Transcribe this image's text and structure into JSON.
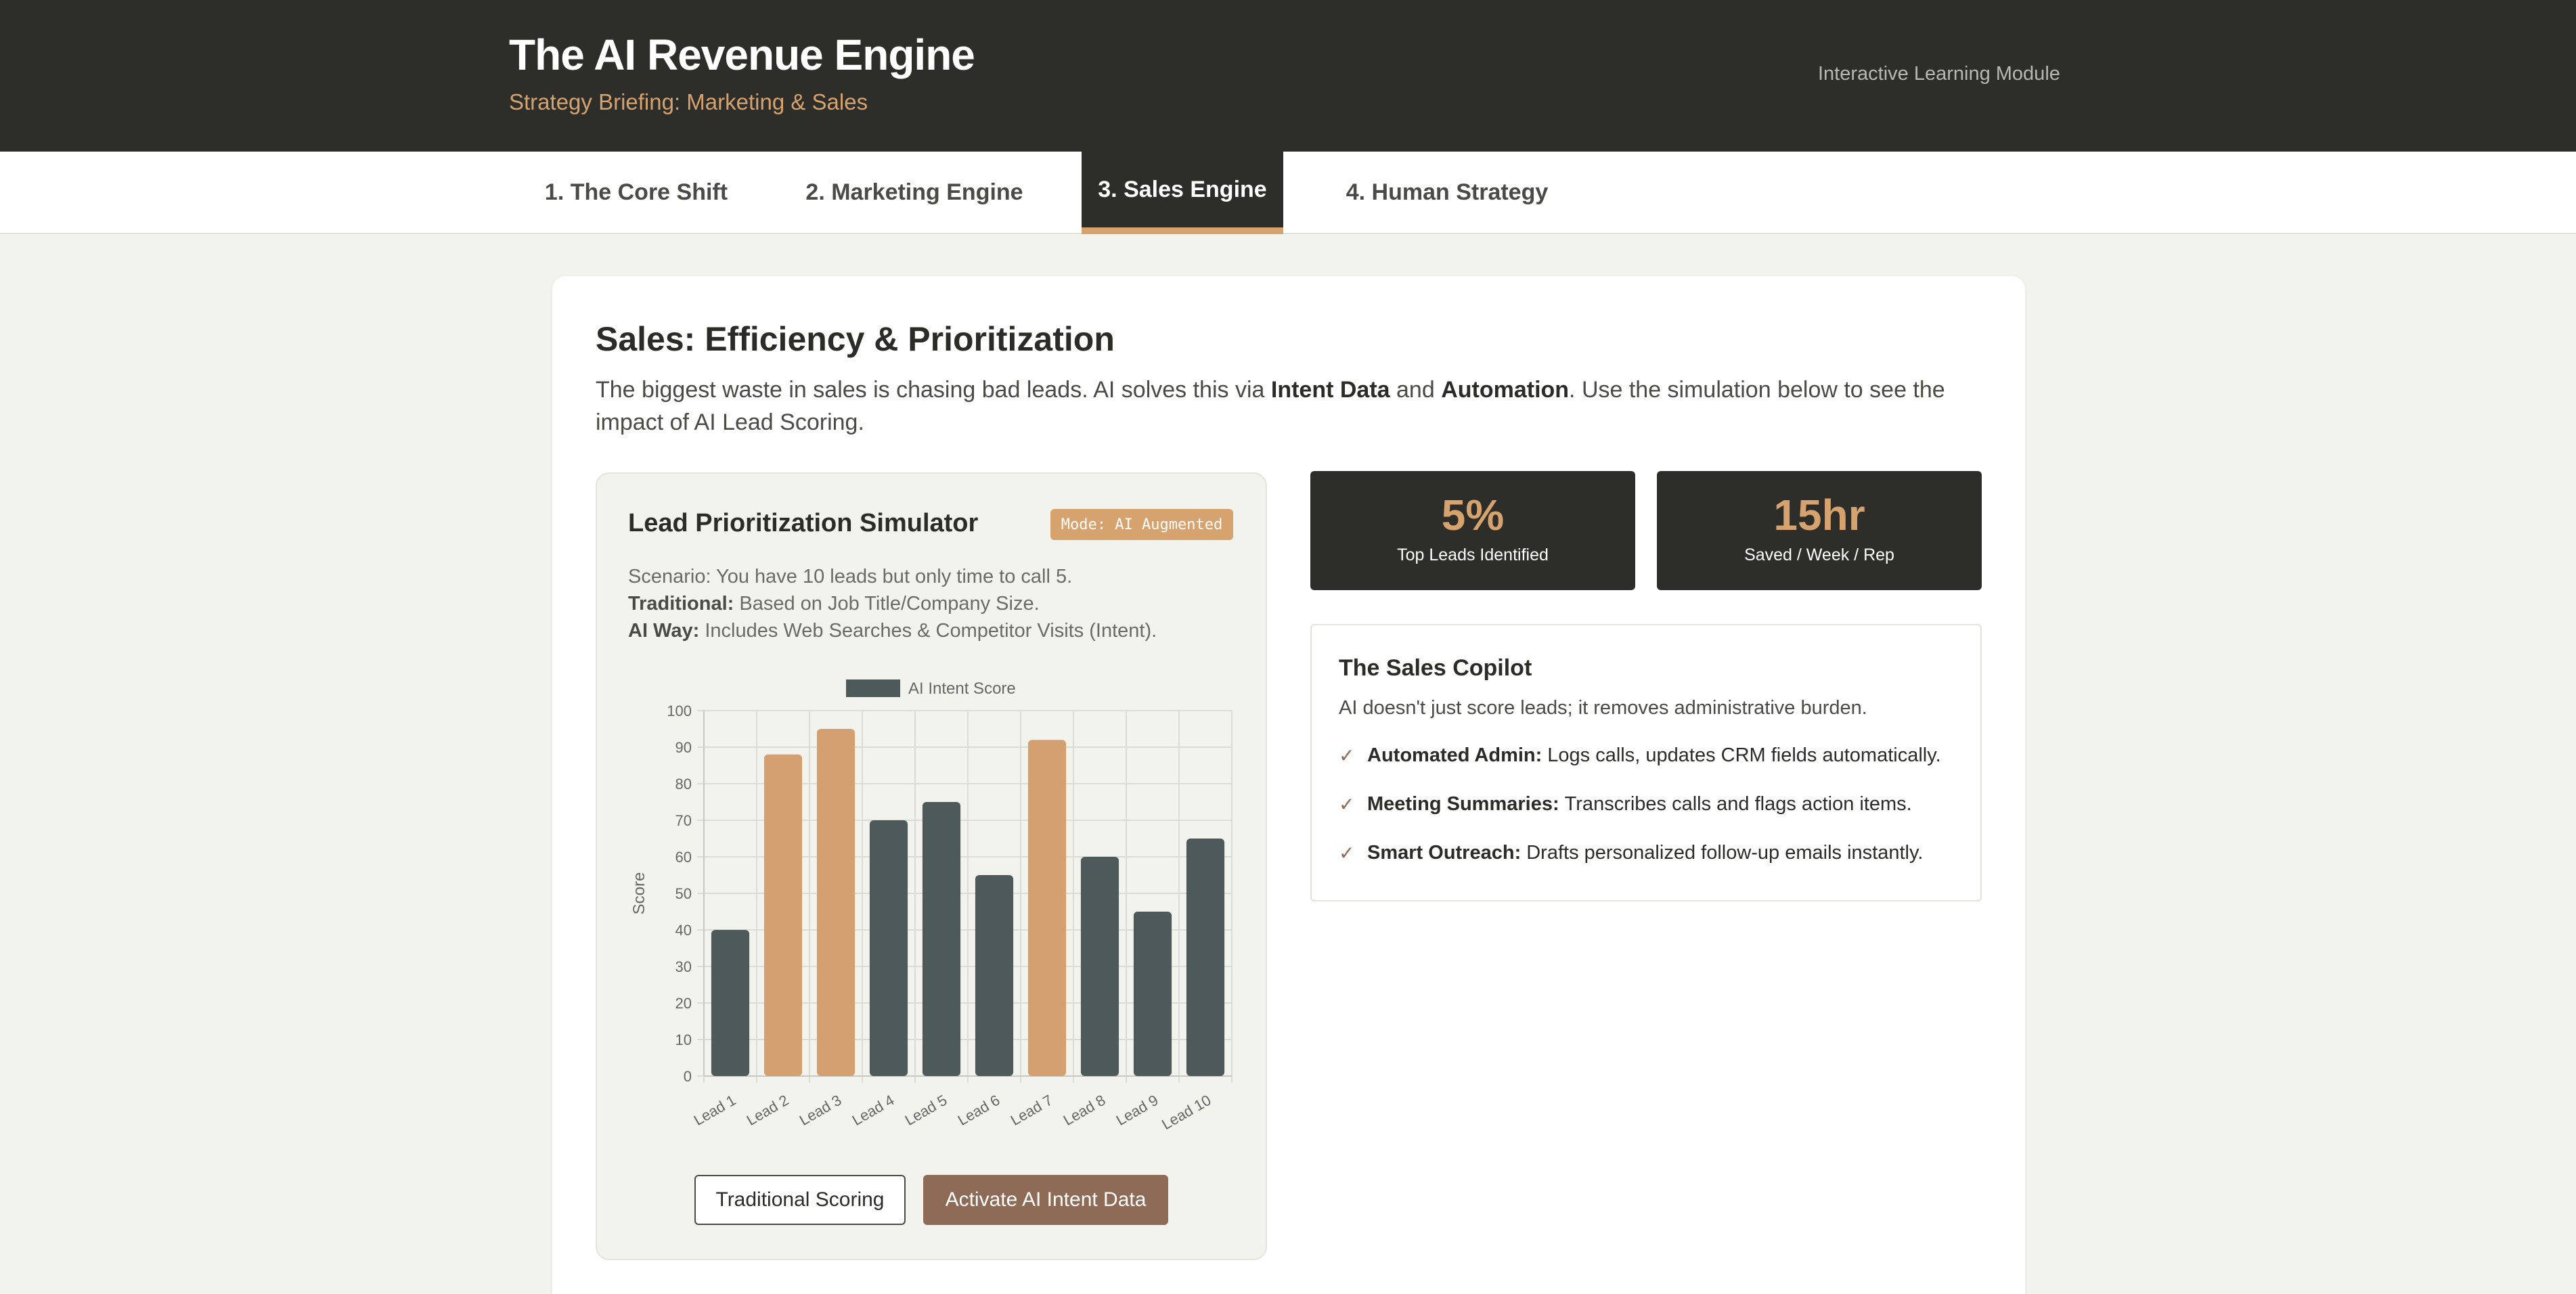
{
  "header": {
    "title": "The AI Revenue Engine",
    "subtitle": "Strategy Briefing: Marketing & Sales",
    "module_label": "Interactive Learning Module"
  },
  "tabs": [
    {
      "label": "1. The Core Shift"
    },
    {
      "label": "2. Marketing Engine"
    },
    {
      "label": "3. Sales Engine",
      "active": true
    },
    {
      "label": "4. Human Strategy"
    }
  ],
  "section": {
    "title": "Sales: Efficiency & Prioritization",
    "desc_part1": "The biggest waste in sales is chasing bad leads. AI solves this via ",
    "desc_bold1": "Intent Data",
    "desc_part2": " and ",
    "desc_bold2": "Automation",
    "desc_part3": ". Use the simulation below to see the impact of AI Lead Scoring."
  },
  "simulator": {
    "title": "Lead Prioritization Simulator",
    "mode_badge": "Mode: AI Augmented",
    "scenario": "Scenario: You have 10 leads but only time to call 5.",
    "traditional_label": "Traditional:",
    "traditional_text": " Based on Job Title/Company Size.",
    "ai_label": "AI Way:",
    "ai_text": " Includes Web Searches & Competitor Visits (Intent).",
    "btn_traditional": "Traditional Scoring",
    "btn_ai": "Activate AI Intent Data"
  },
  "chart_data": {
    "type": "bar",
    "categories": [
      "Lead 1",
      "Lead 2",
      "Lead 3",
      "Lead 4",
      "Lead 5",
      "Lead 6",
      "Lead 7",
      "Lead 8",
      "Lead 9",
      "Lead 10"
    ],
    "series": [
      {
        "name": "AI Intent Score",
        "values": [
          40,
          88,
          95,
          70,
          75,
          55,
          92,
          60,
          45,
          65
        ]
      }
    ],
    "highlighted": [
      false,
      true,
      true,
      false,
      false,
      false,
      true,
      false,
      false,
      false
    ],
    "colors": {
      "default": "#4d5a59",
      "highlight": "#d4a06f",
      "legend": "#4d5a59"
    },
    "ylabel": "Score",
    "xlabel": "",
    "ylim": [
      0,
      100
    ],
    "yticks": [
      0,
      10,
      20,
      30,
      40,
      50,
      60,
      70,
      80,
      90,
      100
    ],
    "grid": true,
    "legend": "top-center"
  },
  "stats": [
    {
      "value": "5%",
      "label": "Top Leads Identified"
    },
    {
      "value": "15hr",
      "label": "Saved / Week / Rep"
    }
  ],
  "copilot": {
    "title": "The Sales Copilot",
    "desc": "AI doesn't just score leads; it removes administrative burden.",
    "items": [
      {
        "label": "Automated Admin:",
        "text": "Logs calls, updates CRM fields automatically."
      },
      {
        "label": "Meeting Summaries:",
        "text": "Transcribes calls and flags action items."
      },
      {
        "label": "Smart Outreach:",
        "text": "Drafts personalized follow-up emails instantly."
      }
    ]
  }
}
